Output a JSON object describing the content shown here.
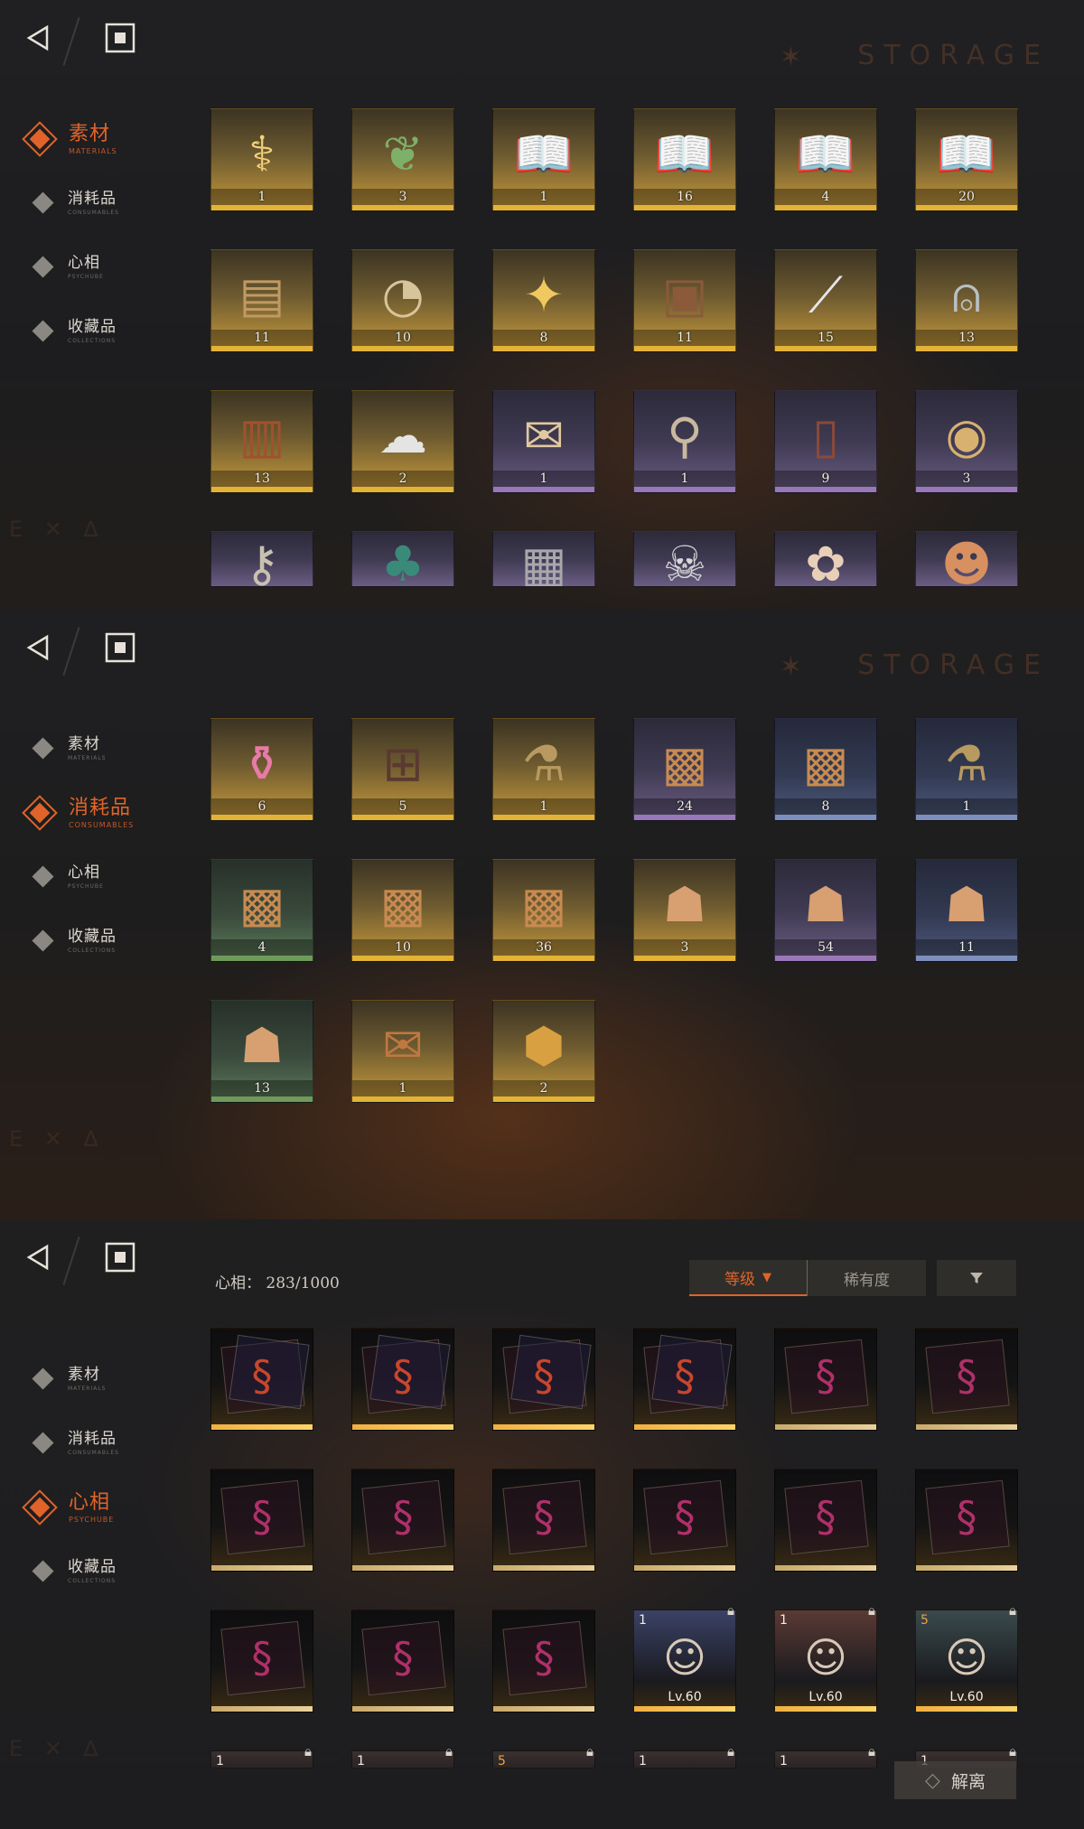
{
  "storage_watermark": "STORAGE",
  "nav": {
    "items": [
      {
        "cn": "素材",
        "en": "MATERIALS"
      },
      {
        "cn": "消耗品",
        "en": "CONSUMABLES"
      },
      {
        "cn": "心相",
        "en": "PSYCHUBE"
      },
      {
        "cn": "收藏品",
        "en": "COLLECTIONS"
      }
    ]
  },
  "icons": {
    "back": "back-triangle-icon",
    "home": "home-square-icon"
  },
  "colors": {
    "accent": "#e0642a",
    "rarity_gold": "#e3b338",
    "rarity_purple": "#9a78b8",
    "rarity_blue": "#7f8fbd",
    "rarity_green": "#6f9a5a"
  },
  "materials": {
    "items": [
      {
        "icon": "caduceus-icon",
        "count": "1",
        "rarity": "gold"
      },
      {
        "icon": "laurel-wreath-icon",
        "count": "3",
        "rarity": "gold"
      },
      {
        "icon": "open-book-red-icon",
        "count": "1",
        "rarity": "gold"
      },
      {
        "icon": "open-book-green-icon",
        "count": "16",
        "rarity": "gold"
      },
      {
        "icon": "open-book-blue-icon",
        "count": "4",
        "rarity": "gold"
      },
      {
        "icon": "open-book-gold-icon",
        "count": "20",
        "rarity": "gold"
      },
      {
        "icon": "ouija-board-icon",
        "count": "11",
        "rarity": "gold"
      },
      {
        "icon": "pocket-watch-icon",
        "count": "10",
        "rarity": "gold"
      },
      {
        "icon": "golden-moth-icon",
        "count": "8",
        "rarity": "gold"
      },
      {
        "icon": "leather-tome-icon",
        "count": "11",
        "rarity": "gold"
      },
      {
        "icon": "silver-spikes-icon",
        "count": "15",
        "rarity": "gold"
      },
      {
        "icon": "bell-jar-icon",
        "count": "13",
        "rarity": "gold"
      },
      {
        "icon": "glove-box-icon",
        "count": "13",
        "rarity": "gold"
      },
      {
        "icon": "ghost-sheet-icon",
        "count": "2",
        "rarity": "gold"
      },
      {
        "icon": "scroll-map-icon",
        "count": "1",
        "rarity": "purple"
      },
      {
        "icon": "quill-tool-icon",
        "count": "1",
        "rarity": "purple"
      },
      {
        "icon": "wooden-case-icon",
        "count": "9",
        "rarity": "purple"
      },
      {
        "icon": "brass-gadget-icon",
        "count": "3",
        "rarity": "purple"
      },
      {
        "icon": "winged-key-icon",
        "count": "",
        "rarity": "purple"
      },
      {
        "icon": "bird-figurine-icon",
        "count": "",
        "rarity": "purple"
      },
      {
        "icon": "metal-device-icon",
        "count": "",
        "rarity": "purple"
      },
      {
        "icon": "skeleton-creature-icon",
        "count": "",
        "rarity": "purple"
      },
      {
        "icon": "plush-toy-icon",
        "count": "",
        "rarity": "purple"
      },
      {
        "icon": "bear-mask-icon",
        "count": "",
        "rarity": "purple"
      }
    ]
  },
  "consumables": {
    "items": [
      {
        "icon": "candy-jar-icon",
        "count": "6",
        "rarity": "gold"
      },
      {
        "icon": "rune-table-icon",
        "count": "5",
        "rarity": "gold"
      },
      {
        "icon": "message-bottle-icon",
        "count": "1",
        "rarity": "gold"
      },
      {
        "icon": "supply-crate-icon",
        "count": "24",
        "rarity": "purple"
      },
      {
        "icon": "supply-crate-icon",
        "count": "8",
        "rarity": "blue"
      },
      {
        "icon": "message-bottle-icon",
        "count": "1",
        "rarity": "blue"
      },
      {
        "icon": "supply-crate-icon",
        "count": "4",
        "rarity": "green"
      },
      {
        "icon": "supply-crate-icon",
        "count": "10",
        "rarity": "gold"
      },
      {
        "icon": "supply-crate-icon",
        "count": "36",
        "rarity": "gold"
      },
      {
        "icon": "cloth-bundle-icon",
        "count": "3",
        "rarity": "gold"
      },
      {
        "icon": "cloth-bundle-icon",
        "count": "54",
        "rarity": "purple"
      },
      {
        "icon": "cloth-bundle-icon",
        "count": "11",
        "rarity": "blue"
      },
      {
        "icon": "cloth-bundle-icon",
        "count": "13",
        "rarity": "green"
      },
      {
        "icon": "letter-envelope-icon",
        "count": "1",
        "rarity": "gold"
      },
      {
        "icon": "emblem-badge-icon",
        "count": "2",
        "rarity": "gold"
      }
    ]
  },
  "psychube": {
    "count_label": "心相：",
    "count_value": "283/1000",
    "sort": {
      "level": "等级",
      "level_arrow": "▼",
      "rarity": "稀有度",
      "filter_icon": "filter-icon"
    },
    "release_label": "解离",
    "cards": [
      {
        "type": "red-snake",
        "num": "",
        "lv": "",
        "locked": false
      },
      {
        "type": "red-snake",
        "num": "",
        "lv": "",
        "locked": false
      },
      {
        "type": "red-snake",
        "num": "",
        "lv": "",
        "locked": false
      },
      {
        "type": "red-snake",
        "num": "",
        "lv": "",
        "locked": false
      },
      {
        "type": "pink-snake",
        "num": "",
        "lv": "",
        "locked": false
      },
      {
        "type": "pink-snake",
        "num": "",
        "lv": "",
        "locked": false
      },
      {
        "type": "pink-snake",
        "num": "",
        "lv": "",
        "locked": false
      },
      {
        "type": "pink-snake",
        "num": "",
        "lv": "",
        "locked": false
      },
      {
        "type": "pink-snake",
        "num": "",
        "lv": "",
        "locked": false
      },
      {
        "type": "pink-snake",
        "num": "",
        "lv": "",
        "locked": false
      },
      {
        "type": "pink-snake",
        "num": "",
        "lv": "",
        "locked": false
      },
      {
        "type": "pink-snake",
        "num": "",
        "lv": "",
        "locked": false
      },
      {
        "type": "pink-snake",
        "num": "",
        "lv": "",
        "locked": false
      },
      {
        "type": "pink-snake",
        "num": "",
        "lv": "",
        "locked": false
      },
      {
        "type": "pink-snake",
        "num": "",
        "lv": "",
        "locked": false
      },
      {
        "type": "portrait-girl",
        "num": "1",
        "lv": "Lv.60",
        "locked": true
      },
      {
        "type": "portrait-maid",
        "num": "1",
        "lv": "Lv.60",
        "locked": true
      },
      {
        "type": "portrait-silver",
        "num": "5",
        "lv": "Lv.60",
        "locked": true
      },
      {
        "type": "peek",
        "num": "1",
        "lv": "",
        "locked": true
      },
      {
        "type": "peek",
        "num": "1",
        "lv": "",
        "locked": true
      },
      {
        "type": "peek",
        "num": "5",
        "lv": "",
        "locked": true
      },
      {
        "type": "peek",
        "num": "1",
        "lv": "",
        "locked": true
      },
      {
        "type": "peek",
        "num": "1",
        "lv": "",
        "locked": true
      },
      {
        "type": "peek",
        "num": "1",
        "lv": "",
        "locked": true
      }
    ]
  }
}
